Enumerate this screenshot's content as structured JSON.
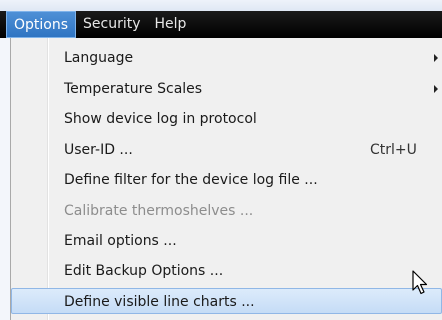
{
  "menubar": {
    "items": [
      {
        "label": "Options",
        "active": true
      },
      {
        "label": "Security",
        "active": false
      },
      {
        "label": "Help",
        "active": false
      }
    ]
  },
  "dropdown": {
    "items": [
      {
        "label": "Language",
        "shortcut": "",
        "submenu": true,
        "disabled": false,
        "highlighted": false
      },
      {
        "label": "Temperature Scales",
        "shortcut": "",
        "submenu": true,
        "disabled": false,
        "highlighted": false
      },
      {
        "label": "Show device log in protocol",
        "shortcut": "",
        "submenu": false,
        "disabled": false,
        "highlighted": false
      },
      {
        "label": "User-ID ...",
        "shortcut": "Ctrl+U",
        "submenu": false,
        "disabled": false,
        "highlighted": false
      },
      {
        "label": "Define filter for the device log file ...",
        "shortcut": "",
        "submenu": false,
        "disabled": false,
        "highlighted": false
      },
      {
        "label": "Calibrate thermoshelves ...",
        "shortcut": "",
        "submenu": false,
        "disabled": true,
        "highlighted": false
      },
      {
        "label": "Email options ...",
        "shortcut": "",
        "submenu": false,
        "disabled": false,
        "highlighted": false
      },
      {
        "label": "Edit Backup Options ...",
        "shortcut": "",
        "submenu": false,
        "disabled": false,
        "highlighted": false
      },
      {
        "label": "Define visible line charts ...",
        "shortcut": "",
        "submenu": false,
        "disabled": false,
        "highlighted": true
      }
    ]
  },
  "colors": {
    "menubar_bg": "#000000",
    "active_menu_bg": "#3a7fcc",
    "highlight_bg": "#cfe3f9",
    "highlight_border": "#90b7e6",
    "disabled_text": "#8d8d8d"
  },
  "icons": {
    "submenu": "chevron-right-icon",
    "cursor": "mouse-pointer-icon"
  }
}
